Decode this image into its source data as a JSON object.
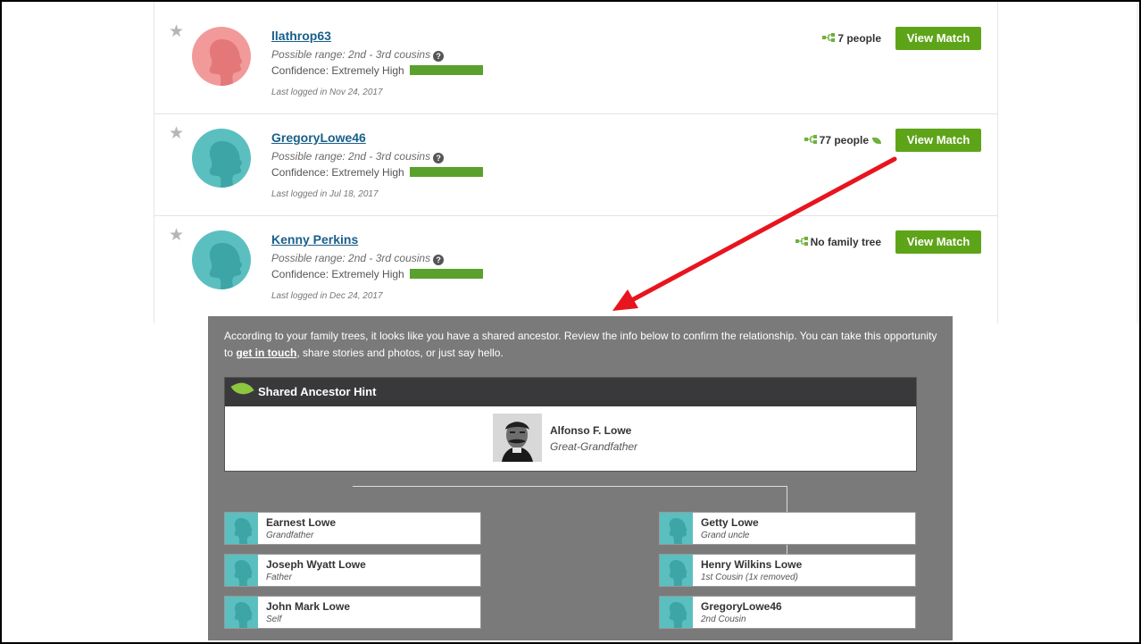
{
  "matches": [
    {
      "username": "llathrop63",
      "range": "Possible range: 2nd - 3rd cousins",
      "confidence": "Confidence: Extremely High",
      "last_logged": "Last logged in Nov 24, 2017",
      "tree": "7 people",
      "avatar_color": "#f29a9a",
      "button": "View Match"
    },
    {
      "username": "GregoryLowe46",
      "range": "Possible range: 2nd - 3rd cousins",
      "confidence": "Confidence: Extremely High",
      "last_logged": "Last logged in Jul 18, 2017",
      "tree": "77 people",
      "avatar_color": "#5bbfc0",
      "button": "View Match"
    },
    {
      "username": "Kenny Perkins",
      "range": "Possible range: 2nd - 3rd cousins",
      "confidence": "Confidence: Extremely High",
      "last_logged": "Last logged in Dec 24, 2017",
      "tree": "No family tree",
      "avatar_color": "#5bbfc0",
      "button": "View Match"
    }
  ],
  "hint": {
    "intro": "According to your family trees, it looks like you have a shared ancestor. Review the info below to confirm the relationship. You can take this opportunity to ",
    "link": "get in touch",
    "outro": ", share stories and photos, or just say hello.",
    "header": "Shared Ancestor Hint",
    "ancestor_name": "Alfonso F. Lowe",
    "ancestor_relation": "Great-Grandfather",
    "left_line": [
      {
        "name": "Earnest Lowe",
        "relation": "Grandfather"
      },
      {
        "name": "Joseph Wyatt Lowe",
        "relation": "Father"
      },
      {
        "name": "John Mark Lowe",
        "relation": "Self"
      }
    ],
    "right_line": [
      {
        "name": "Getty Lowe",
        "relation": "Grand uncle"
      },
      {
        "name": "Henry Wilkins Lowe",
        "relation": "1st Cousin (1x removed)"
      },
      {
        "name": "GregoryLowe46",
        "relation": "2nd Cousin"
      }
    ]
  },
  "colors": {
    "button_green": "#5ea419",
    "confidence_green": "#5aa02c",
    "link_blue": "#1a5f8a",
    "arrow_red": "#e8141e",
    "panel_gray": "#7a7a7a"
  },
  "icons": [
    "star-icon",
    "question-icon",
    "family-tree-icon",
    "leaf-icon",
    "avatar-silhouette-icon"
  ]
}
